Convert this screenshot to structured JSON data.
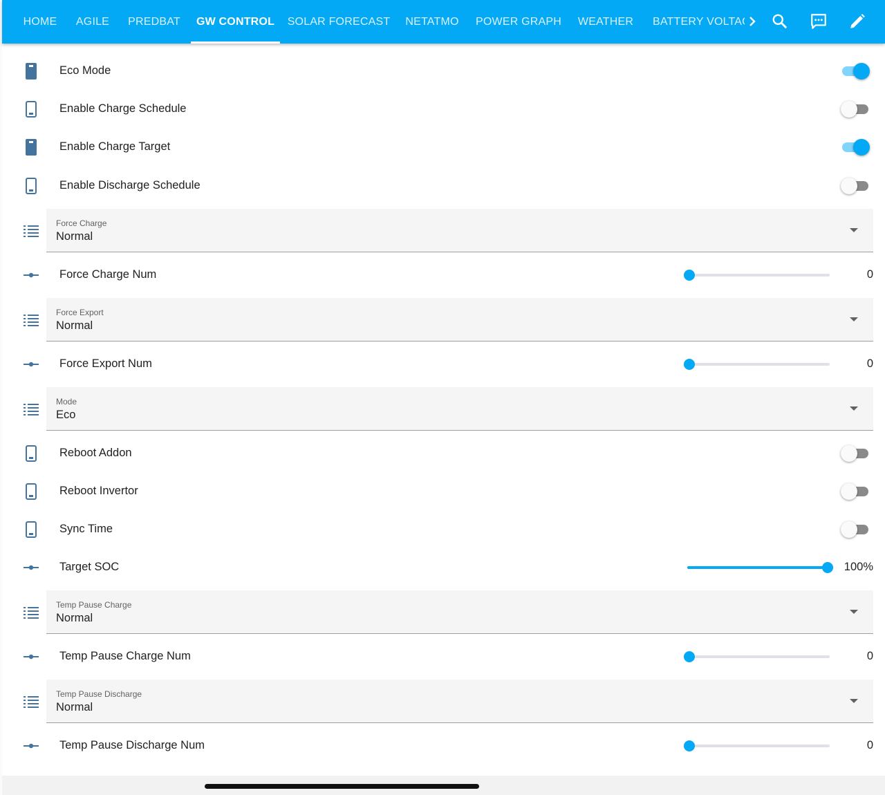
{
  "colors": {
    "header": "#03a9f4",
    "accent": "#03a9f4",
    "icon": "#44739e"
  },
  "nav": {
    "tabs": [
      {
        "label": "HOME",
        "active": false
      },
      {
        "label": "AGILE",
        "active": false
      },
      {
        "label": "PREDBAT",
        "active": false
      },
      {
        "label": "GW CONTROL",
        "active": true
      },
      {
        "label": "SOLAR FORECAST",
        "active": false
      },
      {
        "label": "NETATMO",
        "active": false
      },
      {
        "label": "POWER GRAPH",
        "active": false
      },
      {
        "label": "WEATHER",
        "active": false
      },
      {
        "label": "BATTERY VOLTAG",
        "active": false
      }
    ],
    "icons": [
      "chevron-right-icon",
      "search-icon",
      "assist-chat-icon",
      "edit-pencil-icon"
    ]
  },
  "rows": [
    {
      "type": "toggle",
      "icon": "switch-icon",
      "label": "Eco Mode",
      "on": true
    },
    {
      "type": "toggle",
      "icon": "switch-icon",
      "label": "Enable Charge Schedule",
      "on": false
    },
    {
      "type": "toggle",
      "icon": "switch-icon",
      "label": "Enable Charge Target",
      "on": true
    },
    {
      "type": "toggle",
      "icon": "switch-icon",
      "label": "Enable Discharge Schedule",
      "on": false
    },
    {
      "type": "select",
      "icon": "list-icon",
      "label": "Force Charge",
      "value": "Normal"
    },
    {
      "type": "slider",
      "icon": "slider-icon",
      "label": "Force Charge Num",
      "value_text": "0",
      "fraction": 0
    },
    {
      "type": "select",
      "icon": "list-icon",
      "label": "Force Export",
      "value": "Normal"
    },
    {
      "type": "slider",
      "icon": "slider-icon",
      "label": "Force Export Num",
      "value_text": "0",
      "fraction": 0
    },
    {
      "type": "select",
      "icon": "list-icon",
      "label": "Mode",
      "value": "Eco"
    },
    {
      "type": "toggle",
      "icon": "switch-icon",
      "label": "Reboot Addon",
      "on": false
    },
    {
      "type": "toggle",
      "icon": "switch-icon",
      "label": "Reboot Invertor",
      "on": false
    },
    {
      "type": "toggle",
      "icon": "switch-icon",
      "label": "Sync Time",
      "on": false
    },
    {
      "type": "slider",
      "icon": "slider-icon",
      "label": "Target SOC",
      "value_text": "100%",
      "fraction": 1
    },
    {
      "type": "select",
      "icon": "list-icon",
      "label": "Temp Pause Charge",
      "value": "Normal"
    },
    {
      "type": "slider",
      "icon": "slider-icon",
      "label": "Temp Pause Charge Num",
      "value_text": "0",
      "fraction": 0
    },
    {
      "type": "select",
      "icon": "list-icon",
      "label": "Temp Pause Discharge",
      "value": "Normal"
    },
    {
      "type": "slider",
      "icon": "slider-icon",
      "label": "Temp Pause Discharge Num",
      "value_text": "0",
      "fraction": 0
    }
  ]
}
